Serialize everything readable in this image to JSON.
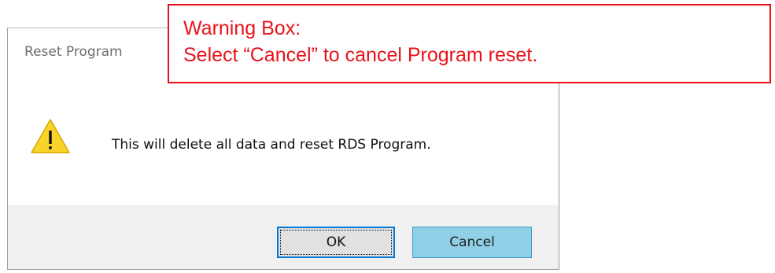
{
  "dialog": {
    "title": "Reset Program",
    "message": "This will delete all data and reset RDS Program.",
    "icon": "warning-icon",
    "buttons": {
      "ok_label": "OK",
      "cancel_label": "Cancel"
    }
  },
  "annotation": {
    "line1": "Warning Box:",
    "line2": "Select “Cancel” to cancel Program reset.",
    "color": "#e8121a"
  },
  "colors": {
    "warning_yellow": "#f9d22a",
    "cancel_button_fill": "#8fd0e6",
    "ok_focus_border": "#0078d7",
    "footer_bg": "#f0f0f0"
  }
}
